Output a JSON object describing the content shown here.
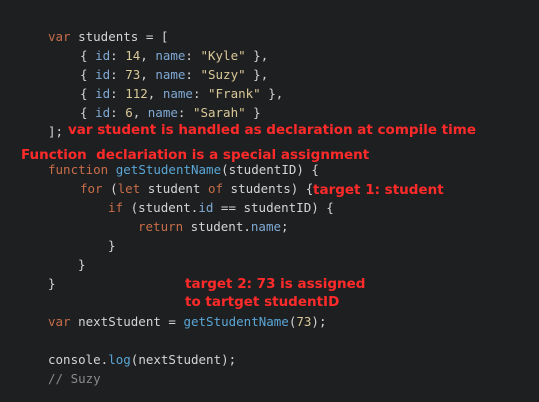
{
  "code": {
    "l1": {
      "kw": "var",
      "name": " students = ["
    },
    "l2": {
      "open": "{ ",
      "k_id": "id",
      "c1": ": ",
      "v_id": "14",
      "c2": ", ",
      "k_name": "name",
      "c3": ": ",
      "v_name": "\"Kyle\"",
      "close": " },"
    },
    "l3": {
      "open": "{ ",
      "k_id": "id",
      "c1": ": ",
      "v_id": "73",
      "c2": ", ",
      "k_name": "name",
      "c3": ": ",
      "v_name": "\"Suzy\"",
      "close": " },"
    },
    "l4": {
      "open": "{ ",
      "k_id": "id",
      "c1": ": ",
      "v_id": "112",
      "c2": ", ",
      "k_name": "name",
      "c3": ": ",
      "v_name": "\"Frank\"",
      "close": " },"
    },
    "l5": {
      "open": "{ ",
      "k_id": "id",
      "c1": ": ",
      "v_id": "6",
      "c2": ", ",
      "k_name": "name",
      "c3": ": ",
      "v_name": "\"Sarah\"",
      "close": " }"
    },
    "l6": {
      "text": "];"
    },
    "l7": {
      "kw": "function",
      "fn": " getStudentName",
      "rest": "(studentID) {"
    },
    "l8": {
      "kw": "for",
      "p1": " (",
      "kw2": "let",
      "p2": " student ",
      "kw3": "of",
      "p3": " students) {"
    },
    "l9": {
      "kw": "if",
      "p1": " (student.",
      "prop": "id",
      "p2": " == studentID) {"
    },
    "l10": {
      "kw": "return",
      "p1": " student.",
      "prop": "name",
      "p2": ";"
    },
    "l11": {
      "text": "}"
    },
    "l12": {
      "text": "}"
    },
    "l13": {
      "text": "}"
    },
    "l14": {
      "kw": "var",
      "p1": " nextStudent = ",
      "fn": "getStudentName",
      "p2": "(",
      "num": "73",
      "p3": ");"
    },
    "l15": {
      "p1": "console.",
      "fn": "log",
      "p2": "(nextStudent);"
    },
    "l16": {
      "text": "// Suzy"
    }
  },
  "annotations": {
    "a1": "var student is handled as declaration at compile time",
    "a2": "Function  declariation is a special assignment",
    "a3": "target 1: student",
    "a4_line1": "target 2: 73 is assigned",
    "a4_line2": "to tartget studentID"
  },
  "colors": {
    "background": "#1e1f20",
    "keyword": "#c86d4a",
    "function": "#5aa6d6",
    "string": "#d9c898",
    "annotation": "#ff2a2a"
  }
}
